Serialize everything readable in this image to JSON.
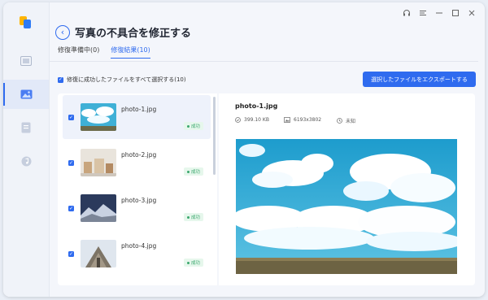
{
  "header": {
    "title": "写真の不具合を修正する"
  },
  "tabs": [
    {
      "label": "修復準備中(0)"
    },
    {
      "label": "修復結果(10)"
    }
  ],
  "toolbar": {
    "select_all_label": "修復に成功したファイルをすべて選択する(10)",
    "export_label": "選択したファイルをエクスポートする"
  },
  "files": [
    {
      "name": "photo-1.jpg",
      "status": "成功"
    },
    {
      "name": "photo-2.jpg",
      "status": "成功"
    },
    {
      "name": "photo-3.jpg",
      "status": "成功"
    },
    {
      "name": "photo-4.jpg",
      "status": "成功"
    }
  ],
  "preview": {
    "filename": "photo-1.jpg",
    "size": "399.10 KB",
    "dimensions": "6193x3802",
    "date": "未知"
  },
  "colors": {
    "accent": "#2f6bef",
    "success": "#3aa76d"
  }
}
